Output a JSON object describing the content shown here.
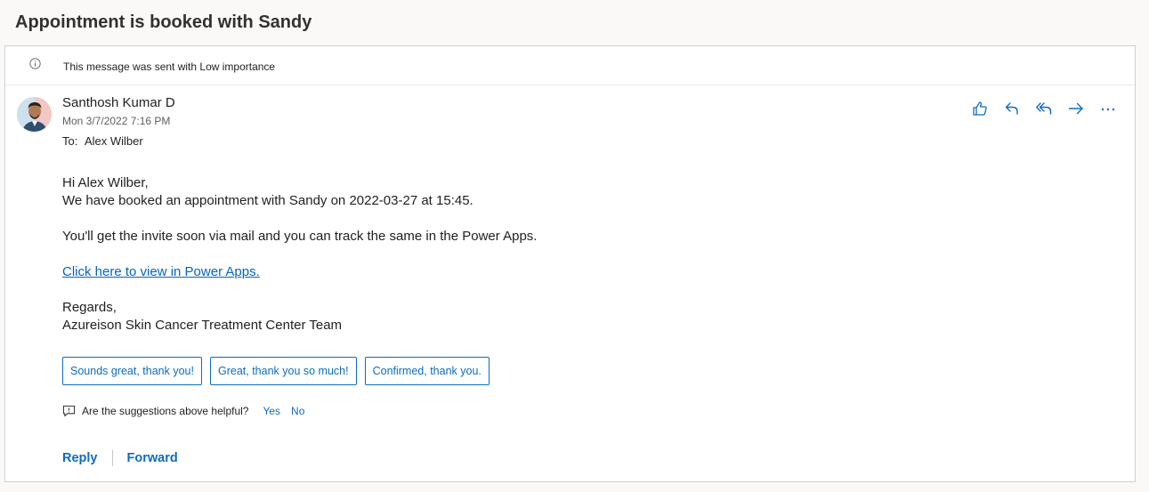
{
  "subject": "Appointment is booked with Sandy",
  "importance": {
    "icon": "info-icon",
    "text": "This message was sent with Low importance"
  },
  "message": {
    "sender": "Santhosh Kumar D",
    "date": "Mon 3/7/2022 7:16 PM",
    "to_label": "To:",
    "to_name": "Alex Wilber",
    "actions": [
      {
        "name": "like",
        "icon": "thumbs-up-icon"
      },
      {
        "name": "reply",
        "icon": "reply-icon"
      },
      {
        "name": "reply-all",
        "icon": "reply-all-icon"
      },
      {
        "name": "forward",
        "icon": "forward-icon"
      },
      {
        "name": "more",
        "icon": "more-icon"
      }
    ],
    "body": {
      "greeting": "Hi Alex Wilber,",
      "line1": "We have booked an appointment with Sandy on 2022-03-27 at 15:45.",
      "line2": "You'll get the invite soon via mail and you can track the same in the Power Apps.",
      "link": "Click here to view in Power Apps.",
      "regards": "Regards,",
      "signature": "Azureison Skin Cancer Treatment Center Team"
    }
  },
  "suggestions": [
    "Sounds great, thank you!",
    "Great, thank you so much!",
    "Confirmed, thank you."
  ],
  "feedback": {
    "question": "Are the suggestions above helpful?",
    "yes": "Yes",
    "no": "No"
  },
  "bottom": {
    "reply": "Reply",
    "forward": "Forward"
  },
  "colors": {
    "accent": "#0f6cbd",
    "link": "#0563c1"
  }
}
